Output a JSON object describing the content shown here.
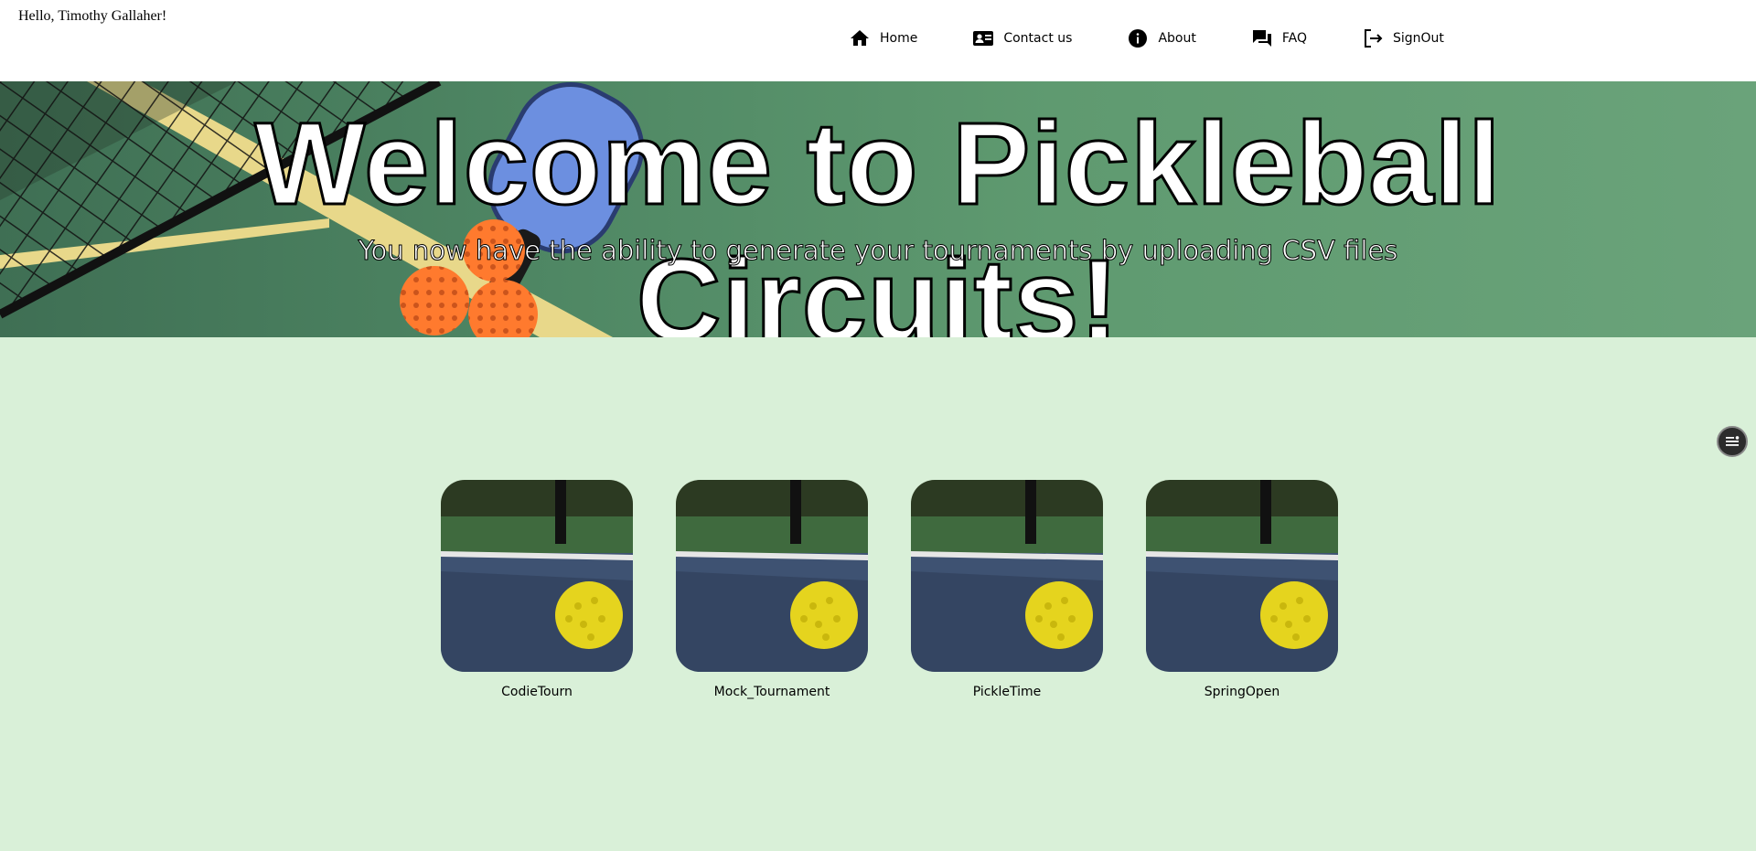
{
  "header": {
    "greeting": "Hello, Timothy Gallaher!",
    "nav": [
      {
        "label": "Home",
        "icon": "home-icon"
      },
      {
        "label": "Contact us",
        "icon": "contact-card-icon"
      },
      {
        "label": "About",
        "icon": "info-icon"
      },
      {
        "label": "FAQ",
        "icon": "forum-icon"
      },
      {
        "label": "SignOut",
        "icon": "logout-icon"
      }
    ]
  },
  "hero": {
    "title": "Welcome to Pickleball Circuits!",
    "subtitle": "You now have the ability to generate your tournaments by uploading CSV files"
  },
  "tournaments": [
    {
      "name": "CodieTourn"
    },
    {
      "name": "Mock_Tournament"
    },
    {
      "name": "PickleTime"
    },
    {
      "name": "SpringOpen"
    }
  ],
  "colors": {
    "page_background": "#d9f0d8",
    "header_background": "#ffffff",
    "court_green": "#4e8663"
  }
}
